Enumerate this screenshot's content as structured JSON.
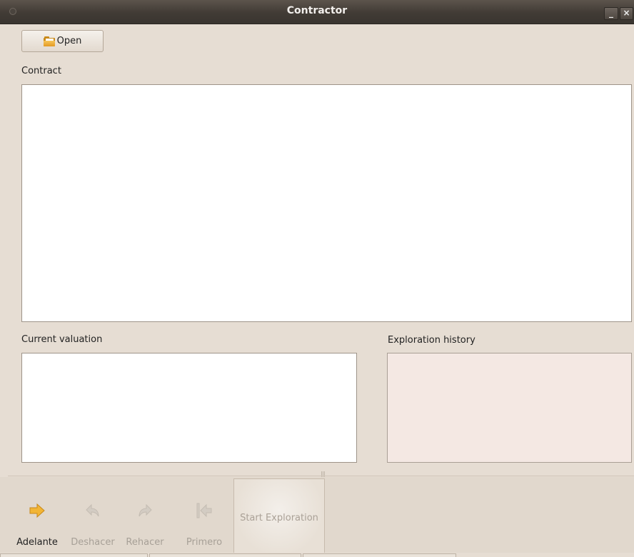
{
  "window": {
    "title": "Contractor"
  },
  "toolbar_top": {
    "open_label": "Open"
  },
  "sections": {
    "contract_label": "Contract",
    "current_valuation_label": "Current valuation",
    "exploration_history_label": "Exploration history"
  },
  "bottom_toolbar": {
    "adelante": "Adelante",
    "deshacer": "Deshacer",
    "rehacer": "Rehacer",
    "primero": "Primero",
    "start_exploration": "Start Exploration"
  },
  "colors": {
    "window_bg": "#e6ddd3",
    "titlebar": "#413b35",
    "forward_arrow": "#f0b030",
    "history_bg": "#f4e8e3"
  },
  "icons": {
    "open": "folder-icon",
    "adelante": "arrow-right-icon",
    "deshacer": "undo-icon",
    "rehacer": "redo-icon",
    "primero": "go-first-icon"
  }
}
